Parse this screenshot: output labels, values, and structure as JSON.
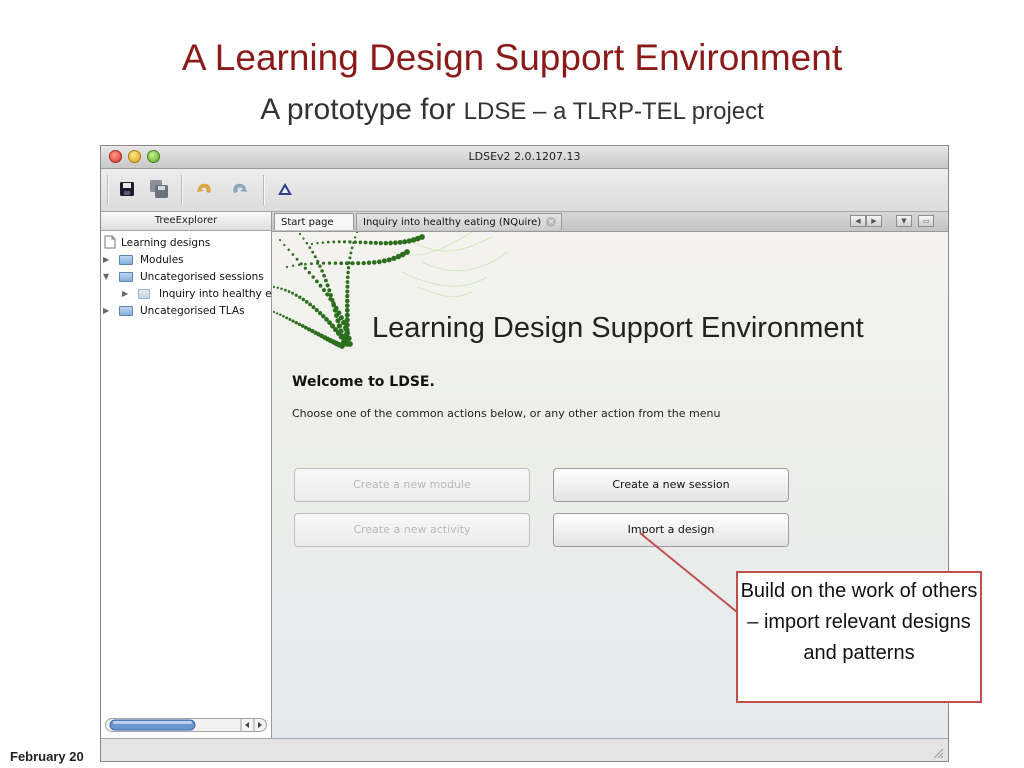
{
  "slide": {
    "title": "A Learning Design Support Environment",
    "subtitle_main": "A prototype for",
    "subtitle_rest": "LDSE – a TLRP-TEL project",
    "footer": "February 20",
    "callout": "Build on the work of others – import relevant designs and patterns"
  },
  "window": {
    "title": "LDSEv2 2.0.1207.13"
  },
  "toolbar": {
    "icons": [
      "save-icon",
      "save-all-icon",
      "undo-icon",
      "redo-icon",
      "triangle-icon"
    ]
  },
  "tree": {
    "header": "TreeExplorer",
    "root": "Learning designs",
    "items": [
      {
        "label": "Modules"
      },
      {
        "label": "Uncategorised sessions"
      },
      {
        "label": "Inquiry into healthy e"
      },
      {
        "label": "Uncategorised TLAs"
      }
    ]
  },
  "tabs": [
    {
      "label": "Start page"
    },
    {
      "label": "Inquiry into healthy eating (NQuire)"
    }
  ],
  "start_page": {
    "banner": "Learning Design Support Environment",
    "welcome": "Welcome to LDSE.",
    "instructions": "Choose one of the common actions below, or any other action from the menu",
    "buttons": {
      "new_module": "Create a new module",
      "new_session": "Create a new session",
      "new_activity": "Create a new activity",
      "import_design": "Import a design"
    }
  },
  "colors": {
    "title": "#8b1a1a",
    "callout_border": "#c0504d",
    "logo_dots": "#2d6e1f"
  }
}
